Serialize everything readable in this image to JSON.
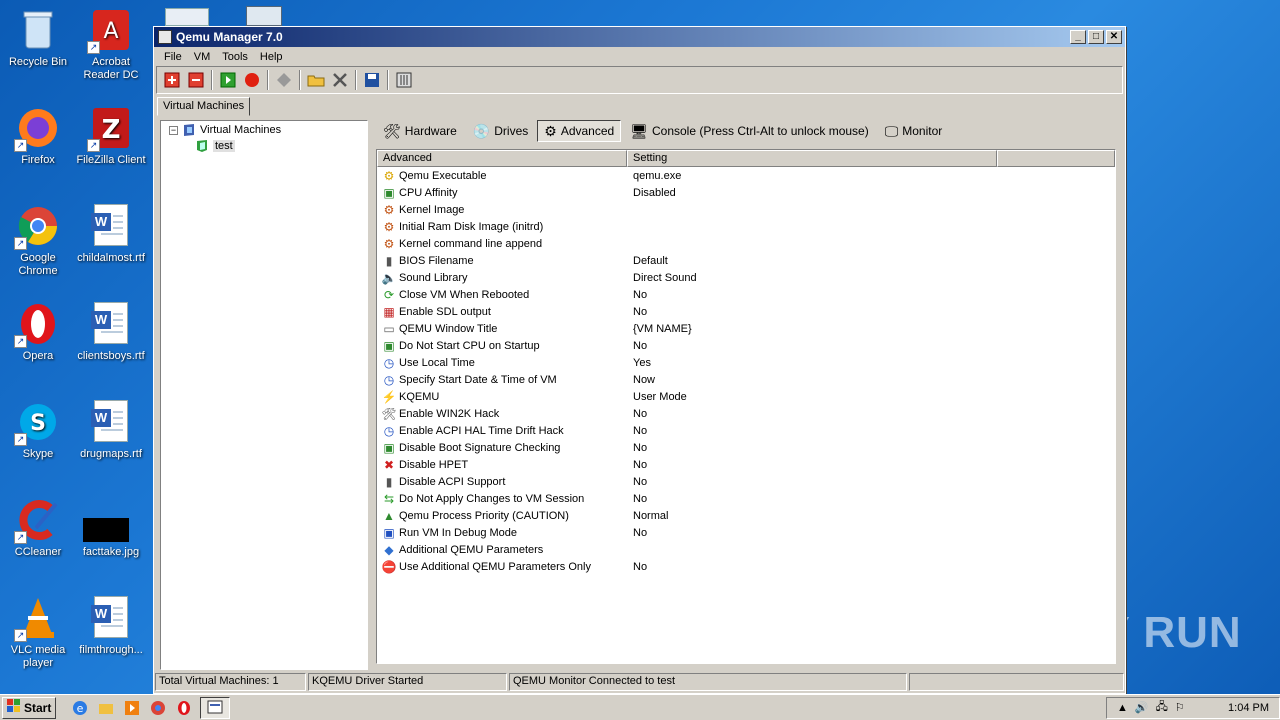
{
  "desktop": {
    "icons": [
      {
        "label": "Recycle Bin",
        "icon": "recycle-bin-icon"
      },
      {
        "label": "Acrobat Reader DC",
        "icon": "acrobat-icon"
      },
      {
        "label": "Firefox",
        "icon": "firefox-icon"
      },
      {
        "label": "FileZilla Client",
        "icon": "filezilla-icon"
      },
      {
        "label": "Google Chrome",
        "icon": "chrome-icon"
      },
      {
        "label": "childalmost.rtf",
        "icon": "word-doc-icon"
      },
      {
        "label": "Opera",
        "icon": "opera-icon"
      },
      {
        "label": "clientsboys.rtf",
        "icon": "word-doc-icon"
      },
      {
        "label": "Skype",
        "icon": "skype-icon"
      },
      {
        "label": "drugmaps.rtf",
        "icon": "word-doc-icon"
      },
      {
        "label": "CCleaner",
        "icon": "ccleaner-icon"
      },
      {
        "label": "facttake.jpg",
        "icon": "image-file-icon"
      },
      {
        "label": "VLC media player",
        "icon": "vlc-icon"
      },
      {
        "label": "filmthrough...",
        "icon": "word-doc-icon"
      }
    ],
    "watermark": "ANY RUN"
  },
  "window": {
    "title": "Qemu Manager 7.0",
    "menu": [
      "File",
      "VM",
      "Tools",
      "Help"
    ],
    "vm_tab": "Virtual Machines",
    "tree": {
      "root": "Virtual Machines",
      "child": "test"
    },
    "tabs": [
      {
        "label": "Hardware",
        "icon": "wrench-icon"
      },
      {
        "label": "Drives",
        "icon": "drive-icon"
      },
      {
        "label": "Advanced",
        "icon": "gears-icon"
      },
      {
        "label": "Console (Press Ctrl-Alt to unlock mouse)",
        "icon": "console-icon"
      },
      {
        "label": "Monitor",
        "icon": "monitor-icon"
      }
    ],
    "list_headers": [
      "Advanced",
      "Setting"
    ],
    "rows": [
      {
        "name": "Qemu Executable",
        "value": "qemu.exe"
      },
      {
        "name": "CPU Affinity",
        "value": "Disabled"
      },
      {
        "name": "Kernel Image",
        "value": ""
      },
      {
        "name": "Initial Ram Disk Image (initrd)",
        "value": ""
      },
      {
        "name": "Kernel command line append",
        "value": ""
      },
      {
        "name": "BIOS Filename",
        "value": "Default"
      },
      {
        "name": "Sound Library",
        "value": "Direct Sound"
      },
      {
        "name": "Close VM When Rebooted",
        "value": "No"
      },
      {
        "name": "Enable SDL output",
        "value": "No"
      },
      {
        "name": "QEMU Window Title",
        "value": "{VM NAME}"
      },
      {
        "name": "Do Not Start CPU on Startup",
        "value": "No"
      },
      {
        "name": "Use Local Time",
        "value": "Yes"
      },
      {
        "name": "Specify Start Date & Time of VM",
        "value": "Now"
      },
      {
        "name": "KQEMU",
        "value": "User Mode"
      },
      {
        "name": "Enable WIN2K Hack",
        "value": "No"
      },
      {
        "name": "Enable ACPI HAL Time Drift Hack",
        "value": "No"
      },
      {
        "name": "Disable Boot Signature Checking",
        "value": "No"
      },
      {
        "name": "Disable HPET",
        "value": "No"
      },
      {
        "name": "Disable ACPI Support",
        "value": "No"
      },
      {
        "name": "Do Not Apply Changes to VM Session",
        "value": "No"
      },
      {
        "name": "Qemu Process Priority (CAUTION)",
        "value": "Normal"
      },
      {
        "name": "Run VM In Debug Mode",
        "value": "No"
      },
      {
        "name": "Additional QEMU Parameters",
        "value": ""
      },
      {
        "name": "Use Additional QEMU Parameters Only",
        "value": "No"
      }
    ],
    "status": [
      "Total Virtual Machines: 1",
      "KQEMU Driver Started",
      "QEMU Monitor Connected to test",
      ""
    ]
  },
  "taskbar": {
    "start": "Start",
    "clock": "1:04 PM"
  }
}
